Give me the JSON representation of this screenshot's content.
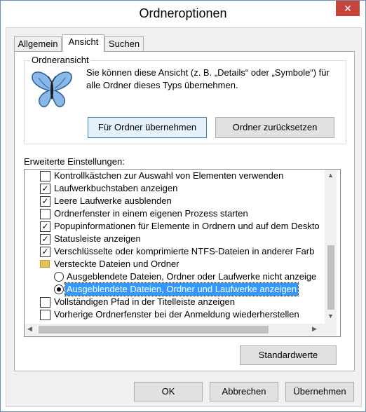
{
  "window": {
    "title": "Ordneroptionen",
    "close_glyph": "✕"
  },
  "tabs": [
    {
      "label": "Allgemein"
    },
    {
      "label": "Ansicht"
    },
    {
      "label": "Suchen"
    }
  ],
  "folder_view": {
    "group_label": "Ordneransicht",
    "icon": "butterfly-icon",
    "description": "Sie können diese Ansicht (z. B. „Details“ oder „Symbole“) für alle Ordner dieses Typs übernehmen.",
    "apply_button": "Für Ordner übernehmen",
    "reset_button": "Ordner zurücksetzen"
  },
  "advanced": {
    "label": "Erweiterte Einstellungen:",
    "items": [
      {
        "text": "Kontrollkästchen zur Auswahl von Elementen verwenden",
        "checked": ""
      },
      {
        "text": "Laufwerkbuchstaben anzeigen",
        "checked": "✓"
      },
      {
        "text": "Leere Laufwerke ausblenden",
        "checked": "✓"
      },
      {
        "text": "Ordnerfenster in einem eigenen Prozess starten",
        "checked": ""
      },
      {
        "text": "Popupinformationen für Elemente in Ordnern und auf dem Deskto",
        "checked": "✓"
      },
      {
        "text": "Statusleiste anzeigen",
        "checked": "✓"
      },
      {
        "text": "Verschlüsselte oder komprimierte NTFS-Dateien in anderer Farb",
        "checked": "✓"
      },
      {
        "text": "Versteckte Dateien und Ordner"
      },
      {
        "text": "Ausgeblendete Dateien, Ordner oder Laufwerke nicht anzeige"
      },
      {
        "text": "Ausgeblendete Dateien, Ordner und Laufwerke anzeigen"
      },
      {
        "text": "Vollständigen Pfad in der Titelleiste anzeigen",
        "checked": ""
      },
      {
        "text": "Vorherige Ordnerfenster bei der Anmeldung wiederherstellen",
        "checked": ""
      }
    ],
    "defaults_button": "Standardwerte"
  },
  "footer": {
    "ok": "OK",
    "cancel": "Abbrechen",
    "apply": "Übernehmen"
  }
}
